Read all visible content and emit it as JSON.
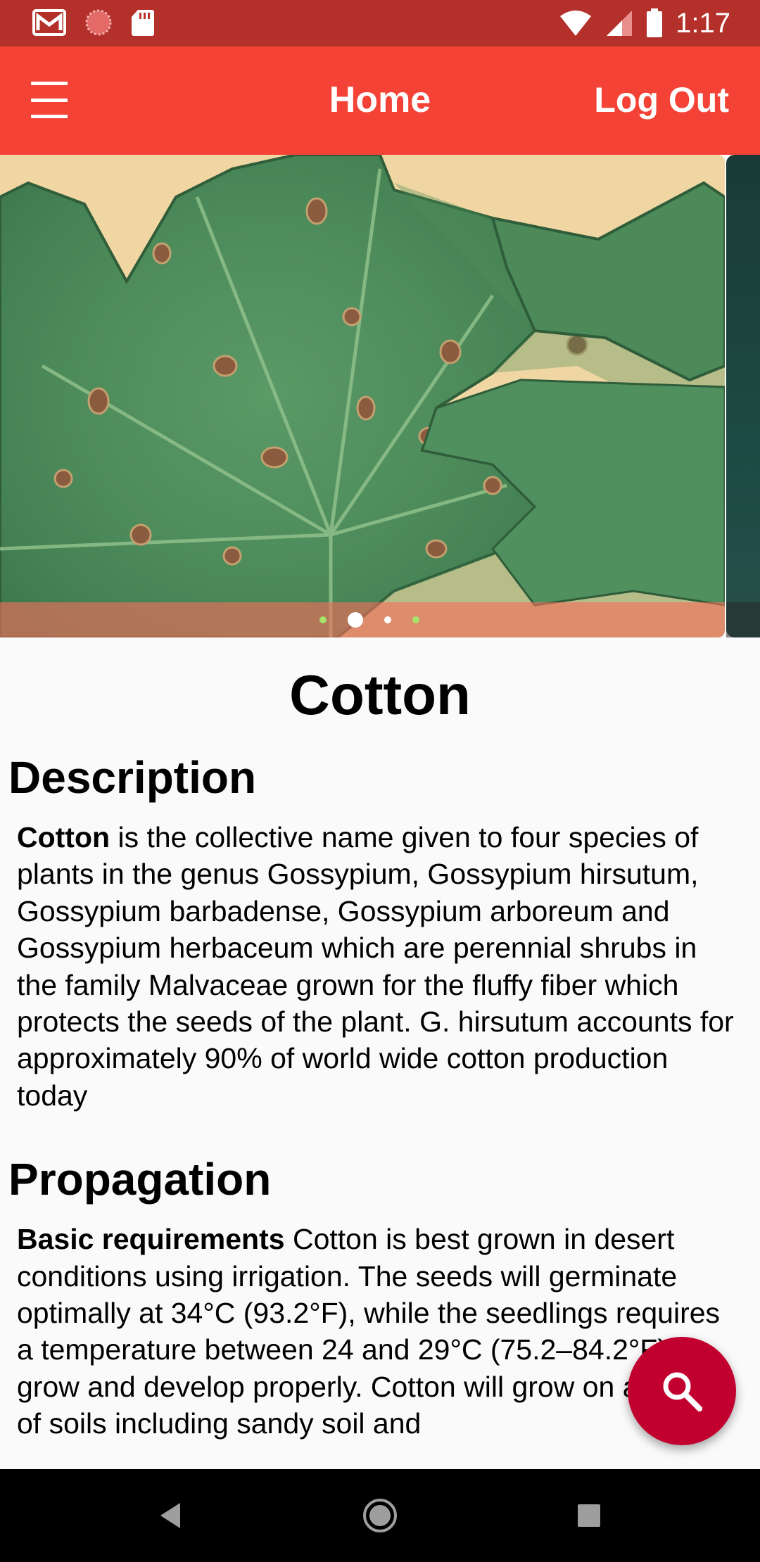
{
  "status_bar": {
    "time": "1:17",
    "left_icons": [
      "gmail-icon",
      "notification-dot-icon",
      "sd-card-icon"
    ],
    "right_icons": [
      "wifi-icon",
      "cell-signal-icon",
      "battery-icon"
    ]
  },
  "app_bar": {
    "title": "Home",
    "logout_label": "Log Out",
    "menu_icon": "hamburger-menu-icon",
    "color": "#f44336"
  },
  "carousel": {
    "slide_count": 4,
    "active_index": 1,
    "dot_colors": [
      "#a6e36a",
      "#ffffff",
      "#ffffff",
      "#a6e36a"
    ]
  },
  "crop": {
    "name": "Cotton",
    "description_heading": "Description",
    "description_bold": "Cotton",
    "description_text": " is the collective name given to four species of plants in the genus Gossypium, Gossypium hirsutum, Gossypium barbadense, Gossypium arboreum and Gossypium herbaceum which are perennial shrubs in the family Malvaceae grown for the fluffy fiber which protects the seeds of the plant. G. hirsutum accounts for approximately 90% of world wide cotton production today",
    "propagation_heading": "Propagation",
    "propagation_bold": "Basic requirements",
    "propagation_text": " Cotton is best grown in desert conditions using irrigation. The seeds will germinate optimally at 34°C (93.2°F), while the seedlings requires a temperature between 24 and 29°C (75.2–84.2°F) to grow and develop properly. Cotton will grow on a variety of soils including sandy soil and"
  },
  "fab": {
    "icon": "search-icon",
    "color": "#c2002f"
  },
  "nav_bar": {
    "icons": [
      "back-icon",
      "home-icon",
      "recents-icon"
    ]
  }
}
